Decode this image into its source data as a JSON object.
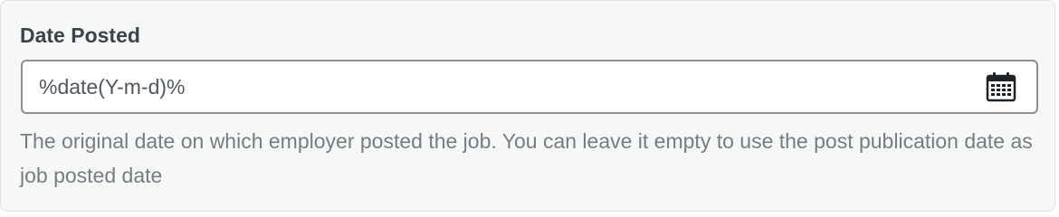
{
  "field": {
    "label": "Date Posted",
    "value": "%date(Y-m-d)%",
    "icon": "calendar-icon",
    "description": "The original date on which employer posted the job. You can leave it empty to use the post publication date as job posted date"
  },
  "colors": {
    "label": "#3c434a",
    "input_text": "#50575e",
    "description": "#787c82",
    "panel_bg": "#f6f7f7",
    "input_border": "#8c8f94"
  }
}
